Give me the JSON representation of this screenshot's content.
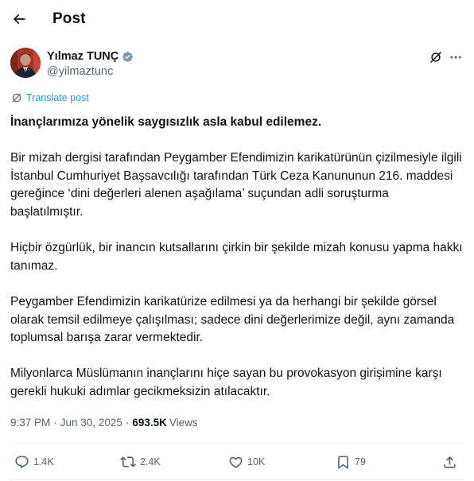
{
  "header": {
    "title": "Post",
    "back_icon": "arrow-left-icon"
  },
  "author": {
    "name": "Yılmaz TUNÇ",
    "handle": "@yilmaztunc",
    "verified_badge": "verified-badge-icon",
    "verified_color": "#71767b"
  },
  "translate": {
    "label": "Translate post",
    "icon": "globe-icon"
  },
  "tweet": {
    "paragraphs": [
      "İnançlarımıza yönelik saygısızlık asla kabul edilemez.",
      "Bir mizah dergisi tarafından Peygamber Efendimizin karikatürünün çizilmesiyle ilgili İstanbul Cumhuriyet Başsavcılığı tarafından Türk Ceza Kanununun 216. maddesi gereğince ‘dini değerleri alenen aşağılama’ suçundan adli soruşturma başlatılmıştır.",
      "Hiçbir özgürlük, bir inancın kutsallarını çirkin bir şekilde mizah konusu yapma hakkı tanımaz.",
      "Peygamber Efendimizin karikatürize edilmesi ya da herhangi bir şekilde görsel olarak temsil edilmeye çalışılması; sadece dini değerlerimize değil, aynı zamanda toplumsal barışa zarar vermektedir.",
      "Milyonlarca Müslümanın inançlarını hiçe sayan bu provokasyon girişimine karşı gerekli hukuki adımlar gecikmeksizin atılacaktır."
    ]
  },
  "meta": {
    "time": "9:37 PM",
    "separator": "·",
    "date": "Jun 30, 2025",
    "views_count": "693.5K",
    "views_label": "Views"
  },
  "actions": {
    "replies": "1.4K",
    "reposts": "2.4K",
    "likes": "10K",
    "bookmarks": "79"
  },
  "colors": {
    "text_primary": "#0f1419",
    "text_secondary": "#536471",
    "link": "#1d9bf0",
    "divider": "#eff3f4"
  }
}
